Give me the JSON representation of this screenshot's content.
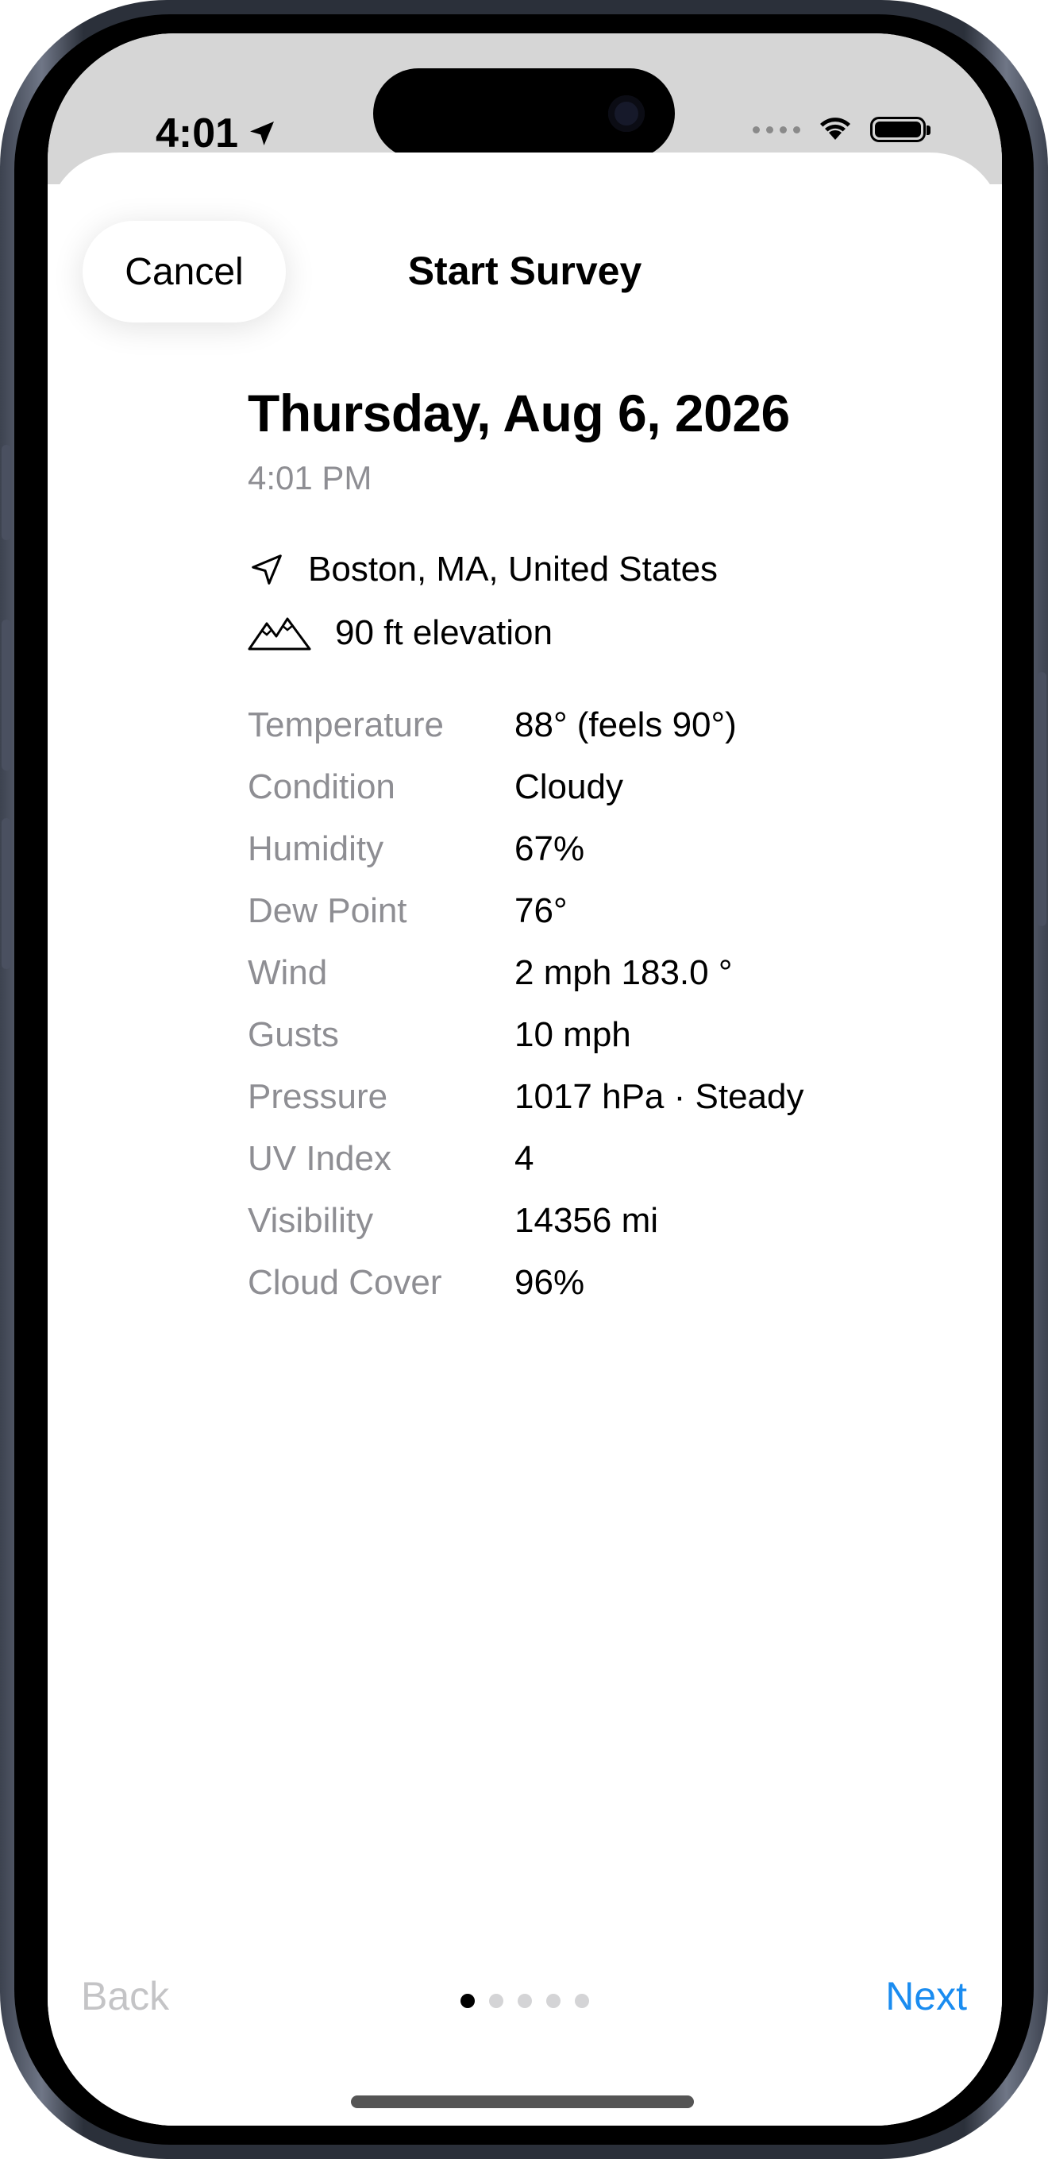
{
  "status_bar": {
    "time": "4:01"
  },
  "nav": {
    "cancel_label": "Cancel",
    "title": "Start Survey"
  },
  "summary": {
    "date": "Thursday, Aug 6, 2026",
    "time": "4:01 PM",
    "location": "Boston, MA, United States",
    "elevation": "90 ft elevation"
  },
  "weather": [
    {
      "label": "Temperature",
      "value": "88° (feels 90°)"
    },
    {
      "label": "Condition",
      "value": "Cloudy"
    },
    {
      "label": "Humidity",
      "value": "67%"
    },
    {
      "label": "Dew Point",
      "value": "76°"
    },
    {
      "label": "Wind",
      "value": "2 mph 183.0 °"
    },
    {
      "label": "Gusts",
      "value": "10 mph"
    },
    {
      "label": "Pressure",
      "value": "1017 hPa · Steady"
    },
    {
      "label": "UV Index",
      "value": "4"
    },
    {
      "label": "Visibility",
      "value": "14356 mi"
    },
    {
      "label": "Cloud Cover",
      "value": "96%"
    }
  ],
  "footer": {
    "back_label": "Back",
    "next_label": "Next",
    "page_count": 5,
    "current_page": 1,
    "accent_color": "#1a8cf0"
  }
}
